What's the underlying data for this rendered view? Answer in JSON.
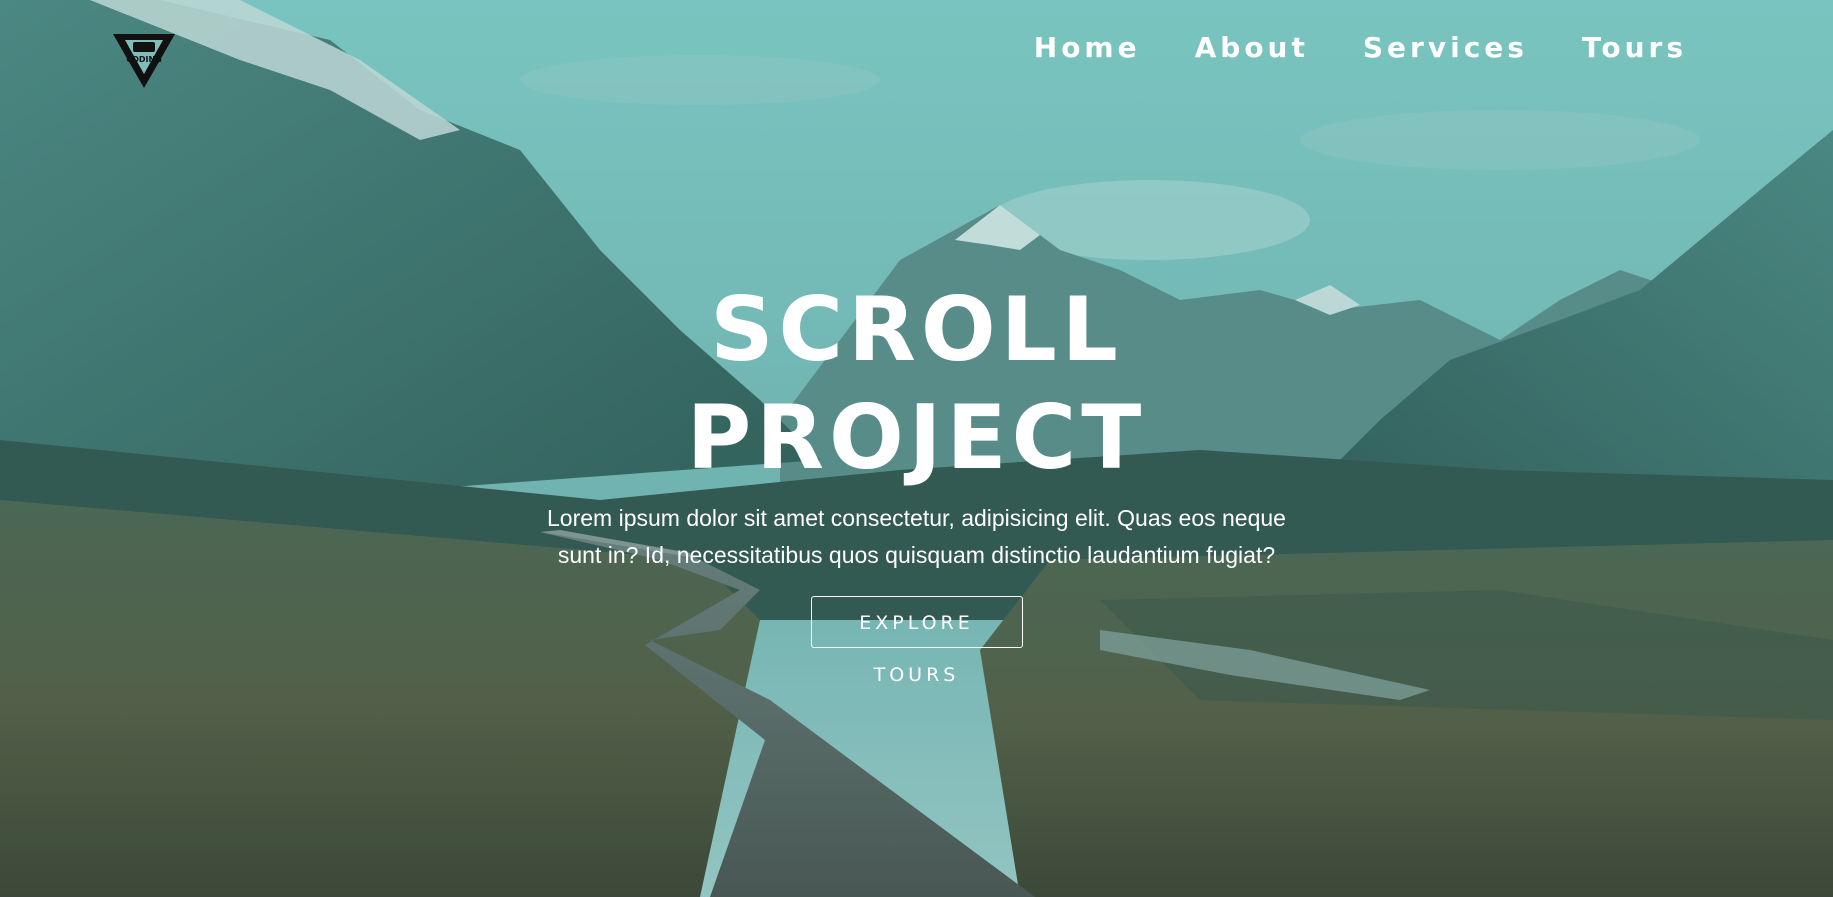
{
  "brand": {
    "logo_text": "CODING",
    "logo_icon": "coding-addict-logo-icon"
  },
  "nav": {
    "items": [
      {
        "label": "Home"
      },
      {
        "label": "About"
      },
      {
        "label": "Services"
      },
      {
        "label": "Tours"
      }
    ]
  },
  "hero": {
    "title_line1": "SCROLL",
    "title_line2": "PROJECT",
    "subtitle_line1": "Lorem ipsum dolor sit amet consectetur, adipisicing elit. Quas eos neque",
    "subtitle_line2": "sunt in? Id, necessitatibus quos quisquam distinctio laudantium fugiat?",
    "cta_label": "EXPLORE TOURS",
    "background_image": "mountain-valley-boardwalk-photo"
  },
  "colors": {
    "overlay_tint": "#3f9691",
    "text": "#ffffff",
    "sky": "#7fc4c0",
    "mountain": "#3c6a66",
    "grass": "#5a5a3c"
  }
}
